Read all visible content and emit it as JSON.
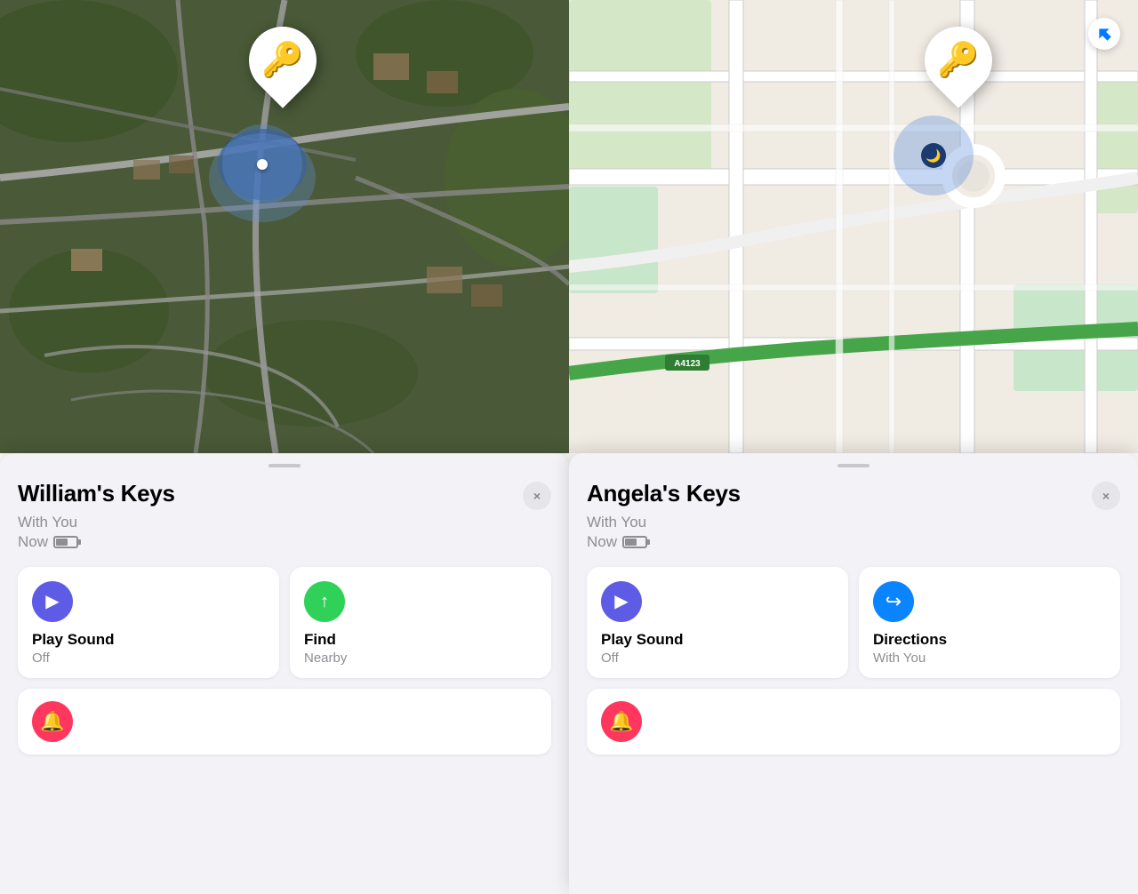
{
  "left_panel": {
    "item_name": "William's Keys",
    "subtitle": "With You",
    "status_time": "Now",
    "close_label": "×",
    "actions": [
      {
        "id": "play-sound",
        "icon": "▶",
        "icon_color": "purple",
        "title": "Play Sound",
        "subtitle": "Off"
      },
      {
        "id": "find-nearby",
        "icon": "↑",
        "icon_color": "green",
        "title": "Find",
        "subtitle": "Nearby"
      }
    ],
    "notification_icon": "🔔"
  },
  "right_panel": {
    "item_name": "Angela's Keys",
    "subtitle": "With You",
    "status_time": "Now",
    "close_label": "×",
    "actions": [
      {
        "id": "play-sound",
        "icon": "▶",
        "icon_color": "purple",
        "title": "Play Sound",
        "subtitle": "Off"
      },
      {
        "id": "directions",
        "icon": "↪",
        "icon_color": "blue",
        "title": "Directions",
        "subtitle": "With You"
      }
    ],
    "notification_icon": "🔔"
  },
  "road_label": "A4123",
  "location_arrow_label": "↗"
}
